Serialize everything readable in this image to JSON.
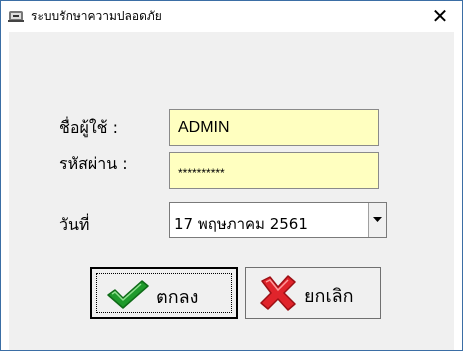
{
  "window": {
    "title": "ระบบรักษาความปลอดภัย",
    "close_glyph": "✕"
  },
  "form": {
    "username_label": "ชื่อผู้ใช้ :",
    "username_value": "ADMIN",
    "password_label": "รหัสผ่าน :",
    "password_value": "**********",
    "date_label": "วันที่",
    "date_value": "17  พฤษภาคม  2561"
  },
  "buttons": {
    "ok_label": "ตกลง",
    "ok_icon": "green-checkmark-icon",
    "cancel_label": "ยกเลิก",
    "cancel_icon": "red-x-icon"
  },
  "colors": {
    "input_background": "#ffffc0",
    "client_background": "#f0f0f0",
    "window_border": "#3b6ea5",
    "check_green": "#1f9a2c",
    "cross_red": "#e0242b"
  }
}
